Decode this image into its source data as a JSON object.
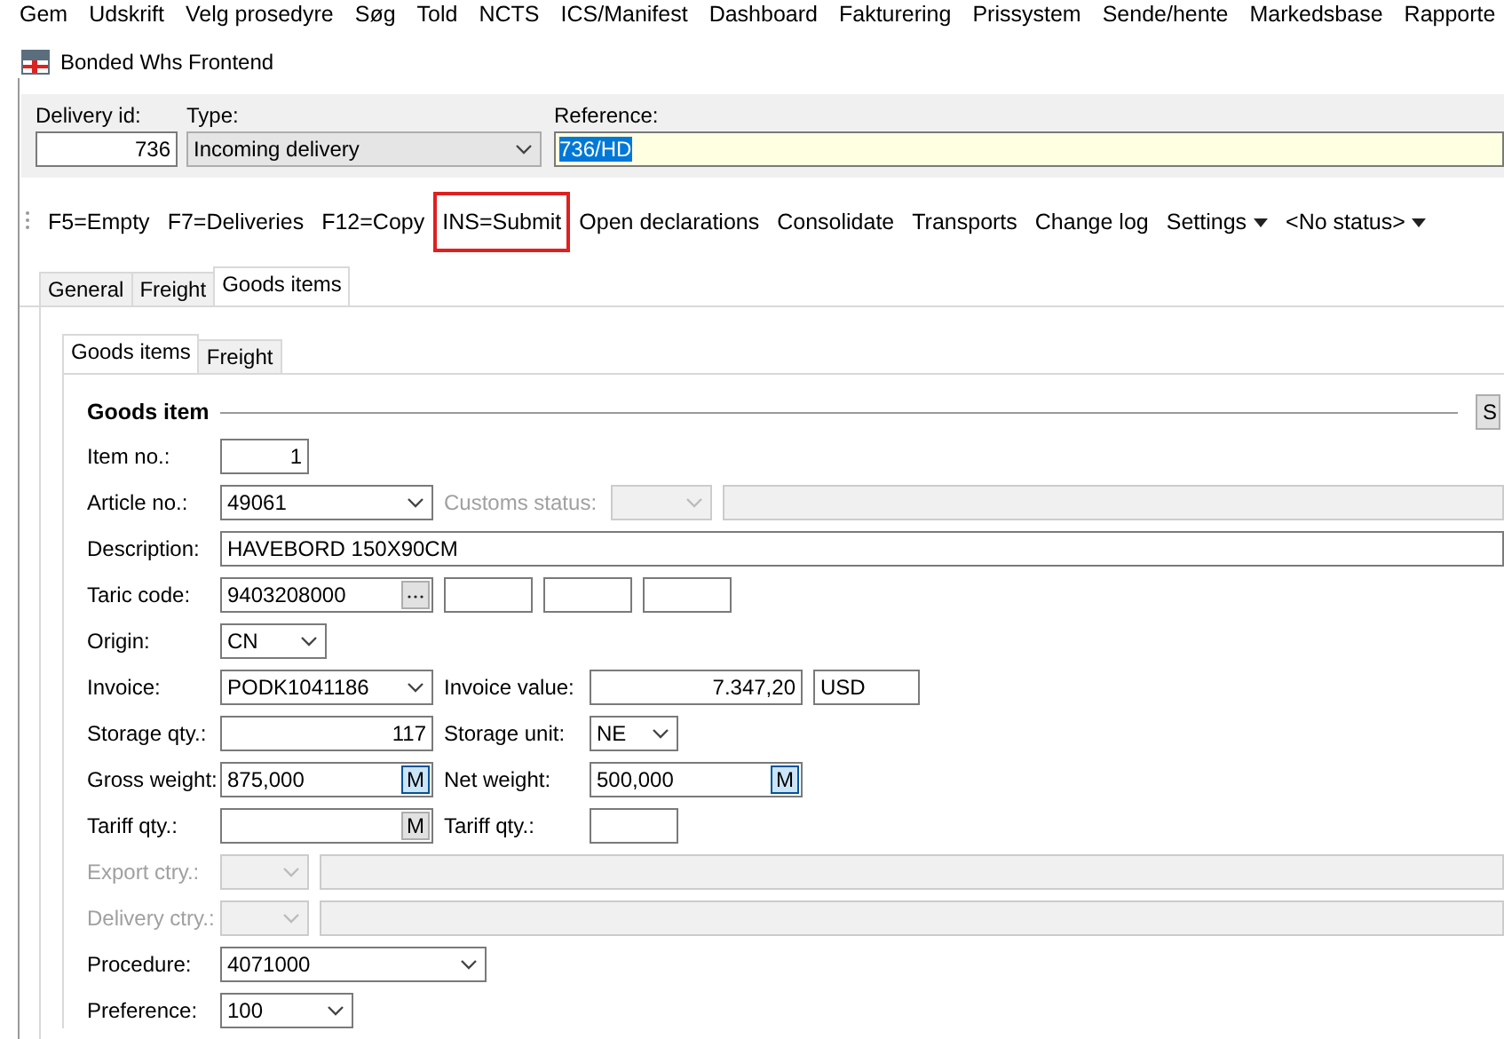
{
  "menu": [
    {
      "label": "Gem"
    },
    {
      "label": "Udskrift"
    },
    {
      "label": "Velg prosedyre"
    },
    {
      "label": "Søg"
    },
    {
      "label": "Told"
    },
    {
      "label": "NCTS"
    },
    {
      "label": "ICS/Manifest"
    },
    {
      "label": "Dashboard"
    },
    {
      "label": "Fakturering"
    },
    {
      "label": "Prissystem"
    },
    {
      "label": "Sende/hente"
    },
    {
      "label": "Markedsbase"
    },
    {
      "label": "Rapporte"
    }
  ],
  "window": {
    "title": "Bonded Whs Frontend"
  },
  "header": {
    "delivery_id": {
      "label": "Delivery id:",
      "value": "736"
    },
    "type": {
      "label": "Type:",
      "value": "Incoming delivery"
    },
    "reference": {
      "label": "Reference:",
      "value": "736/HD",
      "text_selected": true
    }
  },
  "toolbar": [
    {
      "label": "F5=Empty",
      "kind": "button",
      "highlighted": false
    },
    {
      "label": "F7=Deliveries",
      "kind": "button",
      "highlighted": false
    },
    {
      "label": "F12=Copy",
      "kind": "button",
      "highlighted": false
    },
    {
      "label": "INS=Submit",
      "kind": "button",
      "highlighted": true
    },
    {
      "label": "Open declarations",
      "kind": "button",
      "highlighted": false
    },
    {
      "label": "Consolidate",
      "kind": "button",
      "highlighted": false
    },
    {
      "label": "Transports",
      "kind": "button",
      "highlighted": false
    },
    {
      "label": "Change log",
      "kind": "button",
      "highlighted": false
    },
    {
      "label": "Settings",
      "kind": "dropdown",
      "highlighted": false
    },
    {
      "label": "<No status>",
      "kind": "dropdown",
      "highlighted": false
    }
  ],
  "tabs": [
    {
      "label": "General",
      "selected": false
    },
    {
      "label": "Freight",
      "selected": false
    },
    {
      "label": "Goods items",
      "selected": true
    }
  ],
  "subtabs": [
    {
      "label": "Goods items",
      "selected": true
    },
    {
      "label": "Freight",
      "selected": false
    }
  ],
  "goods_item": {
    "title": "Goods item",
    "side_button": "S",
    "item_no": {
      "label": "Item no.:",
      "value": "1"
    },
    "article_no": {
      "label": "Article no.:",
      "value": "49061"
    },
    "customs_status": {
      "label": "Customs status:",
      "disabled": true
    },
    "description": {
      "label": "Description:",
      "value": "HAVEBORD 150X90CM"
    },
    "taric_code": {
      "label": "Taric code:",
      "value": "9403208000"
    },
    "origin": {
      "label": "Origin:",
      "value": "CN"
    },
    "invoice": {
      "label": "Invoice:",
      "value": "PODK1041186"
    },
    "invoice_value": {
      "label": "Invoice value:",
      "value": "7.347,20"
    },
    "currency": {
      "value": "USD"
    },
    "storage_qty": {
      "label": "Storage qty.:",
      "value": "117"
    },
    "storage_unit": {
      "label": "Storage unit:",
      "value": "NE"
    },
    "gross_weight": {
      "label": "Gross weight:",
      "value": "875,000",
      "button": "M",
      "button_active": true
    },
    "net_weight": {
      "label": "Net weight:",
      "value": "500,000",
      "button": "M",
      "button_active": true
    },
    "tariff_qty": {
      "label": "Tariff qty.:",
      "button": "M",
      "button_active": false
    },
    "tariff_qty_2": {
      "label": "Tariff qty.:"
    },
    "export_ctry": {
      "label": "Export ctry.:",
      "disabled": true
    },
    "delivery_ctry": {
      "label": "Delivery ctry.:",
      "disabled": true
    },
    "procedure": {
      "label": "Procedure:",
      "value": "4071000"
    },
    "preference": {
      "label": "Preference:",
      "value": "100"
    }
  }
}
